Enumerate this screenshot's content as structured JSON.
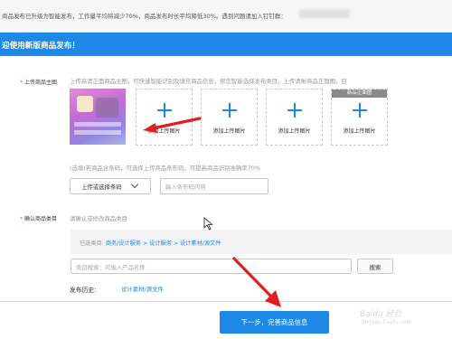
{
  "notice": {
    "text": "商品发布已升级为智能发布，工作量平均将减少70%，商品发布时长平均降低30%。遇到问题请加入钉钉群："
  },
  "banner": {
    "title": "迎使用新版商品发布！"
  },
  "main_image": {
    "label": "上传商品主图",
    "hint": "上传高清正面商品主图，可快速智能识别及填充商品信息，帮您智能选择发布类目，上传清晰商品正面图，目",
    "upload_caption": "添加上传图片",
    "front_tag": "商品正面图"
  },
  "barcode": {
    "hint": "(选填)若商品含条码，可选择上传商品条形码，可提高商品识别准确率70%",
    "upload_button": "上传或选择条码",
    "input_placeholder": "输入条形码内容"
  },
  "category": {
    "label": "确认商品类目",
    "hint": "请确认或修改商品类目",
    "selected_prefix": "已选类目:",
    "selected_path": "商务/设计服务 > 设计服务 > 设计素材/源文件",
    "search_placeholder": "类目搜索：可输入产品名称",
    "search_button": "搜索",
    "history_label": "发布历史:",
    "history_link": "设计素材/源文件"
  },
  "footer": {
    "next_button": "下一步，完善商品信息"
  },
  "watermark": {
    "text": "Baidu 经验",
    "sub": "jingyan.baidu.com"
  },
  "colors": {
    "accent": "#1d88e5",
    "annotation_arrow": "#e02020",
    "required_star": "#f25b2b"
  },
  "icons": [
    "plus-icon",
    "chevron-down-icon",
    "cursor-icon",
    "red-arrow-annotation"
  ]
}
